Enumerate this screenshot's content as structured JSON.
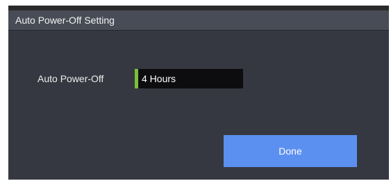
{
  "dialog": {
    "title": "Auto Power-Off Setting"
  },
  "setting": {
    "label": "Auto Power-Off",
    "value": "4 Hours"
  },
  "actions": {
    "done_label": "Done"
  },
  "colors": {
    "background": "#353840",
    "titlebar": "#484c56",
    "value_field": "#0d0d10",
    "accent": "#7bbf3a",
    "done_button": "#5b90f0"
  }
}
